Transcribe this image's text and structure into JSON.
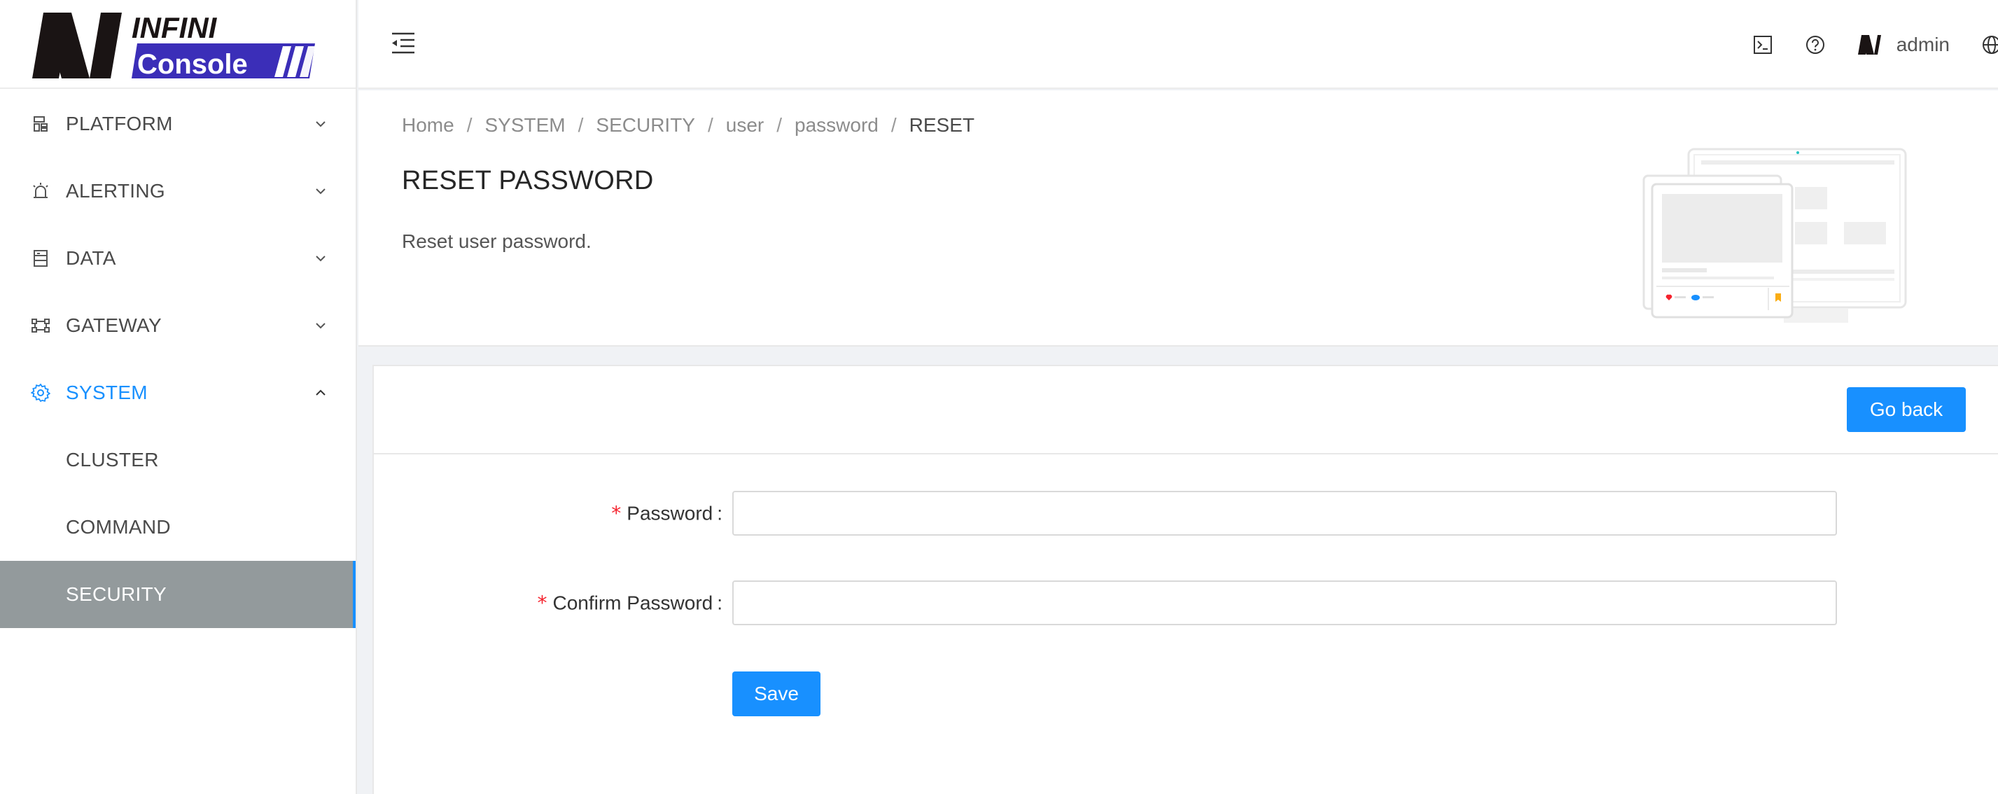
{
  "app": {
    "logo_text_top": "INFINI",
    "logo_text_bottom": "Console"
  },
  "sidebar": {
    "items": [
      {
        "label": "PLATFORM",
        "icon": "platform-icon",
        "state": "collapsed"
      },
      {
        "label": "ALERTING",
        "icon": "alarm-icon",
        "state": "collapsed"
      },
      {
        "label": "DATA",
        "icon": "database-icon",
        "state": "collapsed"
      },
      {
        "label": "GATEWAY",
        "icon": "gateway-icon",
        "state": "collapsed"
      },
      {
        "label": "SYSTEM",
        "icon": "gear-icon",
        "state": "expanded"
      }
    ],
    "subitems": [
      {
        "label": "CLUSTER"
      },
      {
        "label": "COMMAND"
      },
      {
        "label": "SECURITY",
        "selected": true
      }
    ]
  },
  "header": {
    "icons": [
      "menu-fold-icon",
      "console-icon",
      "help-icon",
      "user-logo-icon",
      "globe-icon"
    ],
    "username": "admin"
  },
  "breadcrumb": [
    "Home",
    "SYSTEM",
    "SECURITY",
    "user",
    "password",
    "RESET"
  ],
  "page": {
    "title": "RESET PASSWORD",
    "description": "Reset user password."
  },
  "card": {
    "back_label": "Go back",
    "fields": [
      {
        "label": "Password",
        "required": true,
        "value": ""
      },
      {
        "label": "Confirm Password",
        "required": true,
        "value": ""
      }
    ],
    "save_label": "Save"
  },
  "colors": {
    "primary": "#1890ff",
    "selected_bg": "#939a9c",
    "logo_purple": "#3b2eb8",
    "required": "#f5222d"
  }
}
